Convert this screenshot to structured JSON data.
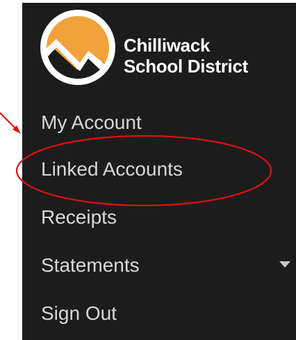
{
  "logo": {
    "line1": "Chilliwack",
    "line2": "School District",
    "icon": "mountain-logo-icon"
  },
  "nav": {
    "items": [
      {
        "label": "My Account"
      },
      {
        "label": "Linked Accounts"
      },
      {
        "label": "Receipts"
      },
      {
        "label": "Statements",
        "icon": "chevron-down-icon"
      },
      {
        "label": "Sign Out"
      }
    ]
  },
  "colors": {
    "sidebar_bg": "#1c1c1c",
    "nav_text": "#d8d8d8",
    "logo_orange": "#f2a23a",
    "annotation_red": "#e01010"
  },
  "annotation": {
    "highlight": "Linked Accounts",
    "shape": "ellipse-with-arrow"
  }
}
